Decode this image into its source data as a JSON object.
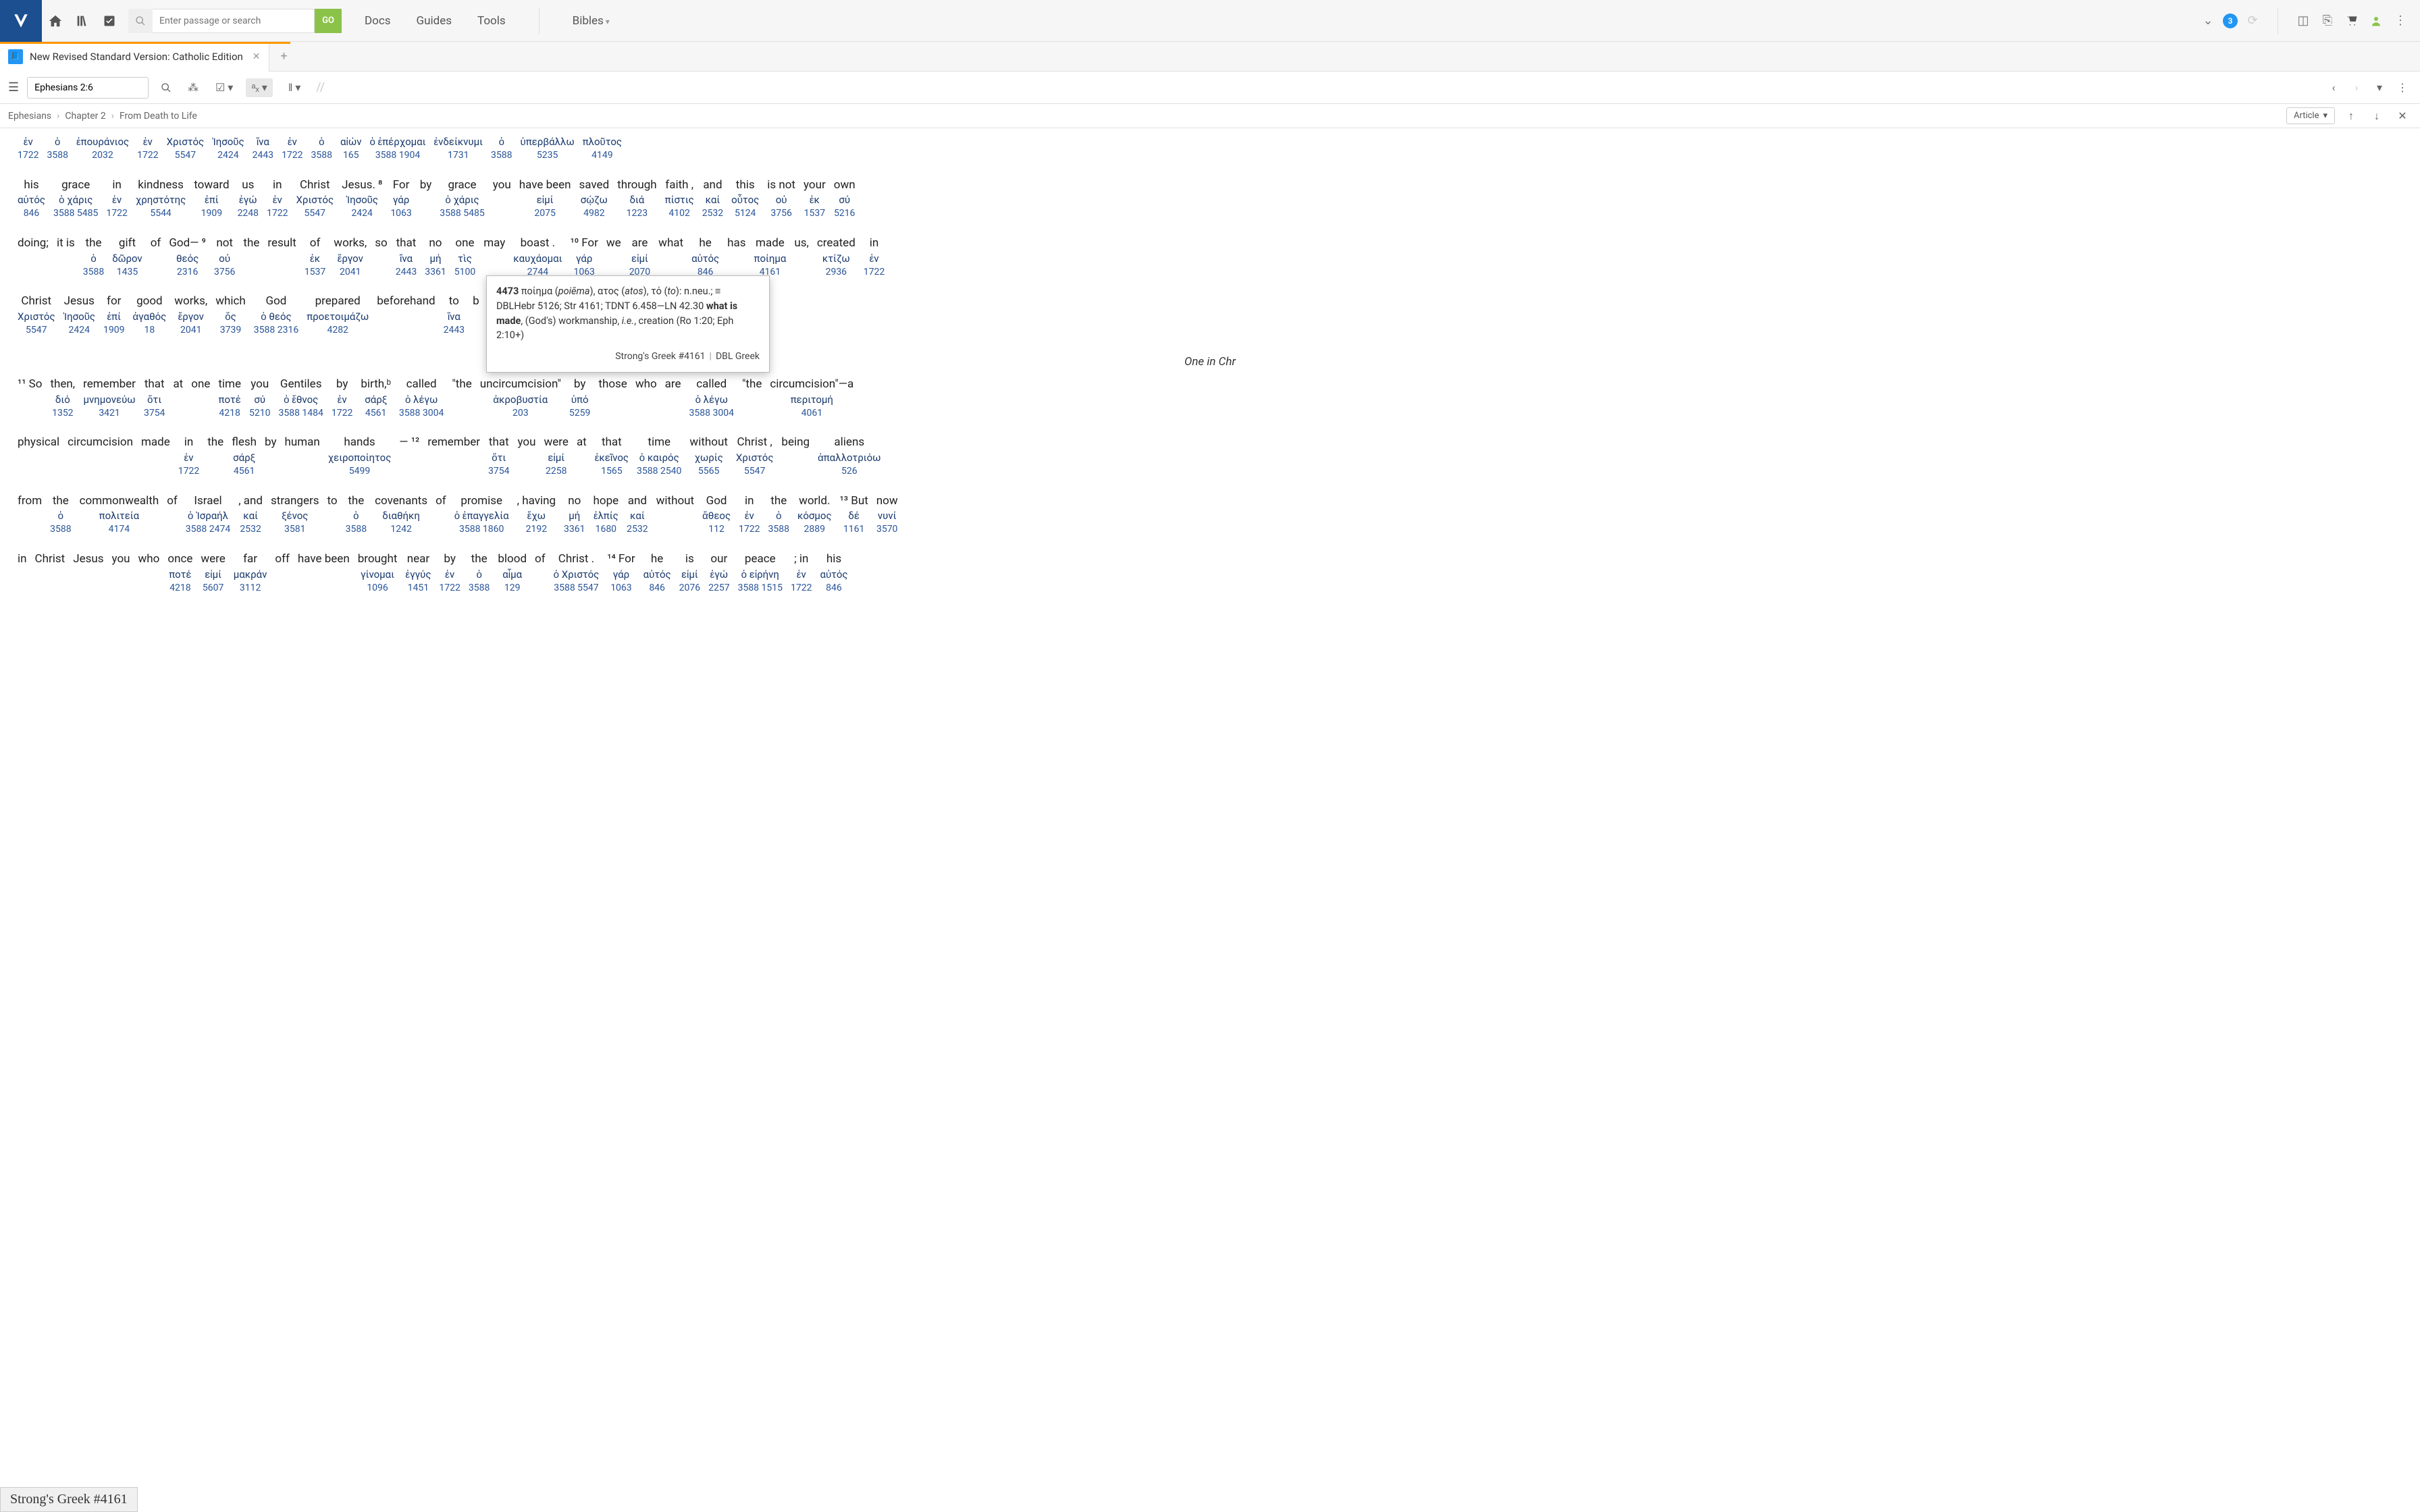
{
  "topbar": {
    "search_placeholder": "Enter passage or search",
    "go_label": "GO",
    "nav": [
      "Docs",
      "Guides",
      "Tools",
      "Bibles"
    ],
    "badge": "3"
  },
  "tab": {
    "title": "New Revised Standard Version: Catholic Edition"
  },
  "toolbar": {
    "reference": "Ephesians 2:6"
  },
  "breadcrumb": {
    "book": "Ephesians",
    "chapter": "Chapter 2",
    "section": "From Death to Life",
    "article_label": "Article"
  },
  "section_title": "One in Chr",
  "tooltip": {
    "num": "4473",
    "lemma": "ποίημα",
    "translit": "poiēma",
    "suffix1": ", ατος (",
    "translit2": "atos",
    "suffix2": "), τό (",
    "translit3": "to",
    "suffix3": "): n.neu.; ≡ DBLHebr 5126; Str 4161; TDNT 6.458—LN 42.30 ",
    "bold_gloss": "what is made",
    "rest": ", (God's) workmanship, ",
    "ital": "i.e.",
    "rest2": ", creation (Ro 1:20; Eph 2:10+)",
    "footer_left": "Strong's Greek #4161",
    "footer_right": "DBL Greek"
  },
  "status": "Strong's Greek #4161",
  "rows": [
    [
      {
        "e": "",
        "g": "ἐν",
        "n": "1722"
      },
      {
        "e": "",
        "g": "ὁ",
        "n": "3588"
      },
      {
        "e": "",
        "g": "ἐπουράνιος",
        "n": "2032"
      },
      {
        "e": "",
        "g": "ἐν",
        "n": "1722"
      },
      {
        "e": "",
        "g": "Χριστός",
        "n": "5547"
      },
      {
        "e": "",
        "g": "Ἰησοῦς",
        "n": "2424"
      },
      {
        "e": "",
        "g": "ἵνα",
        "n": "2443"
      },
      {
        "e": "",
        "g": "ἐν",
        "n": "1722"
      },
      {
        "e": "",
        "g": "ὁ",
        "n": "3588"
      },
      {
        "e": "",
        "g": "αἰών",
        "n": "165"
      },
      {
        "e": "",
        "g": "ὁ ἐπέρχομαι",
        "n": "3588 1904"
      },
      {
        "e": "",
        "g": "ἐνδείκνυμι",
        "n": "1731"
      },
      {
        "e": "",
        "g": "ὁ",
        "n": "3588"
      },
      {
        "e": "",
        "g": "ὑπερβάλλω",
        "n": "5235"
      },
      {
        "e": "",
        "g": "πλοῦτος",
        "n": "4149"
      }
    ],
    [
      {
        "e": "his",
        "g": "αὐτός",
        "n": "846"
      },
      {
        "e": "grace",
        "g": "ὁ χάρις",
        "n": "3588 5485"
      },
      {
        "e": "in",
        "g": "ἐν",
        "n": "1722"
      },
      {
        "e": "kindness",
        "g": "χρηστότης",
        "n": "5544"
      },
      {
        "e": "toward",
        "g": "ἐπί",
        "n": "1909"
      },
      {
        "e": "us",
        "g": "ἐγώ",
        "n": "2248"
      },
      {
        "e": "in",
        "g": "ἐν",
        "n": "1722"
      },
      {
        "e": "Christ",
        "g": "Χριστός",
        "n": "5547"
      },
      {
        "e": "Jesus. ⁸",
        "g": "Ἰησοῦς",
        "n": "2424"
      },
      {
        "e": "For",
        "g": "γάρ",
        "n": "1063"
      },
      {
        "e": "by",
        "g": "",
        "n": ""
      },
      {
        "e": "grace",
        "g": "ὁ χάρις",
        "n": "3588 5485"
      },
      {
        "e": "you",
        "g": "",
        "n": ""
      },
      {
        "e": "have been",
        "g": "εἰμί",
        "n": "2075"
      },
      {
        "e": "saved",
        "g": "σῴζω",
        "n": "4982"
      },
      {
        "e": "through",
        "g": "διά",
        "n": "1223"
      },
      {
        "e": "faith ,",
        "g": "πίστις",
        "n": "4102"
      },
      {
        "e": "and",
        "g": "καί",
        "n": "2532"
      },
      {
        "e": "this",
        "g": "οὗτος",
        "n": "5124"
      },
      {
        "e": "is not",
        "g": "οὐ",
        "n": "3756"
      },
      {
        "e": "your",
        "g": "ἐκ",
        "n": "1537"
      },
      {
        "e": "own",
        "g": "σύ",
        "n": "5216"
      }
    ],
    [
      {
        "e": "doing;",
        "g": "",
        "n": ""
      },
      {
        "e": "it is",
        "g": "",
        "n": ""
      },
      {
        "e": "the",
        "g": "ὁ",
        "n": "3588"
      },
      {
        "e": "gift",
        "g": "δῶρον",
        "n": "1435"
      },
      {
        "e": "of",
        "g": "",
        "n": ""
      },
      {
        "e": "God— ⁹",
        "g": "θεός",
        "n": "2316"
      },
      {
        "e": "not",
        "g": "οὐ",
        "n": "3756"
      },
      {
        "e": "the",
        "g": "",
        "n": ""
      },
      {
        "e": "result",
        "g": "",
        "n": ""
      },
      {
        "e": "of",
        "g": "ἐκ",
        "n": "1537"
      },
      {
        "e": "works,",
        "g": "ἔργον",
        "n": "2041"
      },
      {
        "e": "so",
        "g": "",
        "n": ""
      },
      {
        "e": "that",
        "g": "ἵνα",
        "n": "2443"
      },
      {
        "e": "no",
        "g": "μή",
        "n": "3361"
      },
      {
        "e": "one",
        "g": "τὶς",
        "n": "5100"
      },
      {
        "e": "may",
        "g": "",
        "n": ""
      },
      {
        "e": "boast .",
        "g": "καυχάομαι",
        "n": "2744"
      },
      {
        "e": "¹⁰ For",
        "g": "γάρ",
        "n": "1063"
      },
      {
        "e": "we",
        "g": "",
        "n": ""
      },
      {
        "e": "are",
        "g": "εἰμί",
        "n": "2070"
      },
      {
        "e": "what",
        "g": "",
        "n": ""
      },
      {
        "e": "he",
        "g": "αὐτός",
        "n": "846"
      },
      {
        "e": "has",
        "g": "",
        "n": ""
      },
      {
        "e": "made",
        "g": "ποίημα",
        "n": "4161"
      },
      {
        "e": "us,",
        "g": "",
        "n": ""
      },
      {
        "e": "created",
        "g": "κτίζω",
        "n": "2936"
      },
      {
        "e": "in",
        "g": "ἐν",
        "n": "1722"
      }
    ],
    [
      {
        "e": "Christ",
        "g": "Χριστός",
        "n": "5547"
      },
      {
        "e": "Jesus",
        "g": "Ἰησοῦς",
        "n": "2424"
      },
      {
        "e": "for",
        "g": "ἐπί",
        "n": "1909"
      },
      {
        "e": "good",
        "g": "ἀγαθός",
        "n": "18"
      },
      {
        "e": "works,",
        "g": "ἔργον",
        "n": "2041"
      },
      {
        "e": "which",
        "g": "ὅς",
        "n": "3739"
      },
      {
        "e": "God",
        "g": "ὁ θεός",
        "n": "3588 2316"
      },
      {
        "e": "prepared",
        "g": "προετοιμάζω",
        "n": "4282"
      },
      {
        "e": "beforehand",
        "g": "",
        "n": ""
      },
      {
        "e": "to",
        "g": "ἵνα",
        "n": "2443"
      },
      {
        "e": "b",
        "g": "",
        "n": ""
      }
    ],
    [
      {
        "e": "¹¹ So",
        "g": "",
        "n": ""
      },
      {
        "e": "then,",
        "g": "διό",
        "n": "1352"
      },
      {
        "e": "remember",
        "g": "μνημονεύω",
        "n": "3421"
      },
      {
        "e": "that",
        "g": "ὅτι",
        "n": "3754"
      },
      {
        "e": "at",
        "g": "",
        "n": ""
      },
      {
        "e": "one",
        "g": "",
        "n": ""
      },
      {
        "e": "time",
        "g": "ποτέ",
        "n": "4218"
      },
      {
        "e": "you",
        "g": "σύ",
        "n": "5210"
      },
      {
        "e": "Gentiles",
        "g": "ὁ ἔθνος",
        "n": "3588 1484"
      },
      {
        "e": "by",
        "g": "ἐν",
        "n": "1722"
      },
      {
        "e": "birth,ᵇ",
        "g": "σάρξ",
        "n": "4561"
      },
      {
        "e": "called",
        "g": "ὁ λέγω",
        "n": "3588 3004"
      },
      {
        "e": "\"the",
        "g": "",
        "n": ""
      },
      {
        "e": "uncircumcision\"",
        "g": "ἀκροβυστία",
        "n": "203"
      },
      {
        "e": "by",
        "g": "ὑπό",
        "n": "5259"
      },
      {
        "e": "those",
        "g": "",
        "n": ""
      },
      {
        "e": "who",
        "g": "",
        "n": ""
      },
      {
        "e": "are",
        "g": "",
        "n": ""
      },
      {
        "e": "called",
        "g": "ὁ λέγω",
        "n": "3588 3004"
      },
      {
        "e": "\"the",
        "g": "",
        "n": ""
      },
      {
        "e": "circumcision\"—a",
        "g": "περιτομή",
        "n": "4061"
      }
    ],
    [
      {
        "e": "physical",
        "g": "",
        "n": ""
      },
      {
        "e": "circumcision",
        "g": "",
        "n": ""
      },
      {
        "e": "made",
        "g": "",
        "n": ""
      },
      {
        "e": "in",
        "g": "ἐν",
        "n": "1722"
      },
      {
        "e": "the",
        "g": "",
        "n": ""
      },
      {
        "e": "flesh",
        "g": "σάρξ",
        "n": "4561"
      },
      {
        "e": "by",
        "g": "",
        "n": ""
      },
      {
        "e": "human",
        "g": "",
        "n": ""
      },
      {
        "e": "hands",
        "g": "χειροποίητος",
        "n": "5499"
      },
      {
        "e": "— ¹²",
        "g": "",
        "n": ""
      },
      {
        "e": "remember",
        "g": "",
        "n": ""
      },
      {
        "e": "that",
        "g": "ὅτι",
        "n": "3754"
      },
      {
        "e": "you",
        "g": "",
        "n": ""
      },
      {
        "e": "were",
        "g": "εἰμί",
        "n": "2258"
      },
      {
        "e": "at",
        "g": "",
        "n": ""
      },
      {
        "e": "that",
        "g": "ἐκεῖνος",
        "n": "1565"
      },
      {
        "e": "time",
        "g": "ὁ καιρός",
        "n": "3588 2540"
      },
      {
        "e": "without",
        "g": "χωρίς",
        "n": "5565"
      },
      {
        "e": "Christ ,",
        "g": "Χριστός",
        "n": "5547"
      },
      {
        "e": "being",
        "g": "",
        "n": ""
      },
      {
        "e": "aliens",
        "g": "ἀπαλλοτριόω",
        "n": "526"
      }
    ],
    [
      {
        "e": "from",
        "g": "",
        "n": ""
      },
      {
        "e": "the",
        "g": "ὁ",
        "n": "3588"
      },
      {
        "e": "commonwealth",
        "g": "πολιτεία",
        "n": "4174"
      },
      {
        "e": "of",
        "g": "",
        "n": ""
      },
      {
        "e": "Israel",
        "g": "ὁ Ἰσραήλ",
        "n": "3588 2474"
      },
      {
        "e": ", and",
        "g": "καί",
        "n": "2532"
      },
      {
        "e": "strangers",
        "g": "ξένος",
        "n": "3581"
      },
      {
        "e": "to",
        "g": "",
        "n": ""
      },
      {
        "e": "the",
        "g": "ὁ",
        "n": "3588"
      },
      {
        "e": "covenants",
        "g": "διαθήκη",
        "n": "1242"
      },
      {
        "e": "of",
        "g": "",
        "n": ""
      },
      {
        "e": "promise",
        "g": "ὁ ἐπαγγελία",
        "n": "3588 1860"
      },
      {
        "e": ", having",
        "g": "ἔχω",
        "n": "2192"
      },
      {
        "e": "no",
        "g": "μή",
        "n": "3361"
      },
      {
        "e": "hope",
        "g": "ἐλπίς",
        "n": "1680"
      },
      {
        "e": "and",
        "g": "καί",
        "n": "2532"
      },
      {
        "e": "without",
        "g": "",
        "n": ""
      },
      {
        "e": "God",
        "g": "ἄθεος",
        "n": "112"
      },
      {
        "e": "in",
        "g": "ἐν",
        "n": "1722"
      },
      {
        "e": "the",
        "g": "ὁ",
        "n": "3588"
      },
      {
        "e": "world.",
        "g": "κόσμος",
        "n": "2889"
      },
      {
        "e": "¹³ But",
        "g": "δέ",
        "n": "1161"
      },
      {
        "e": "now",
        "g": "νυνί",
        "n": "3570"
      }
    ],
    [
      {
        "e": "in",
        "g": "",
        "n": ""
      },
      {
        "e": "Christ",
        "g": "",
        "n": ""
      },
      {
        "e": "Jesus",
        "g": "",
        "n": ""
      },
      {
        "e": "you",
        "g": "",
        "n": ""
      },
      {
        "e": "who",
        "g": "",
        "n": ""
      },
      {
        "e": "once",
        "g": "ποτέ",
        "n": "4218"
      },
      {
        "e": "were",
        "g": "εἰμί",
        "n": "5607"
      },
      {
        "e": "far",
        "g": "μακράν",
        "n": "3112"
      },
      {
        "e": "off",
        "g": "",
        "n": ""
      },
      {
        "e": "have been",
        "g": "",
        "n": ""
      },
      {
        "e": "brought",
        "g": "γίνομαι",
        "n": "1096"
      },
      {
        "e": "near",
        "g": "ἐγγύς",
        "n": "1451"
      },
      {
        "e": "by",
        "g": "ἐν",
        "n": "1722"
      },
      {
        "e": "the",
        "g": "ὁ",
        "n": "3588"
      },
      {
        "e": "blood",
        "g": "αἷμα",
        "n": "129"
      },
      {
        "e": "of",
        "g": "",
        "n": ""
      },
      {
        "e": "Christ .",
        "g": "ὁ Χριστός",
        "n": "3588 5547"
      },
      {
        "e": "¹⁴ For",
        "g": "γάρ",
        "n": "1063"
      },
      {
        "e": "he",
        "g": "αὐτός",
        "n": "846"
      },
      {
        "e": "is",
        "g": "εἰμί",
        "n": "2076"
      },
      {
        "e": "our",
        "g": "ἐγώ",
        "n": "2257"
      },
      {
        "e": "peace",
        "g": "ὁ εἰρήνη",
        "n": "3588 1515"
      },
      {
        "e": "; in",
        "g": "ἐν",
        "n": "1722"
      },
      {
        "e": "his",
        "g": "αὐτός",
        "n": "846"
      }
    ]
  ]
}
